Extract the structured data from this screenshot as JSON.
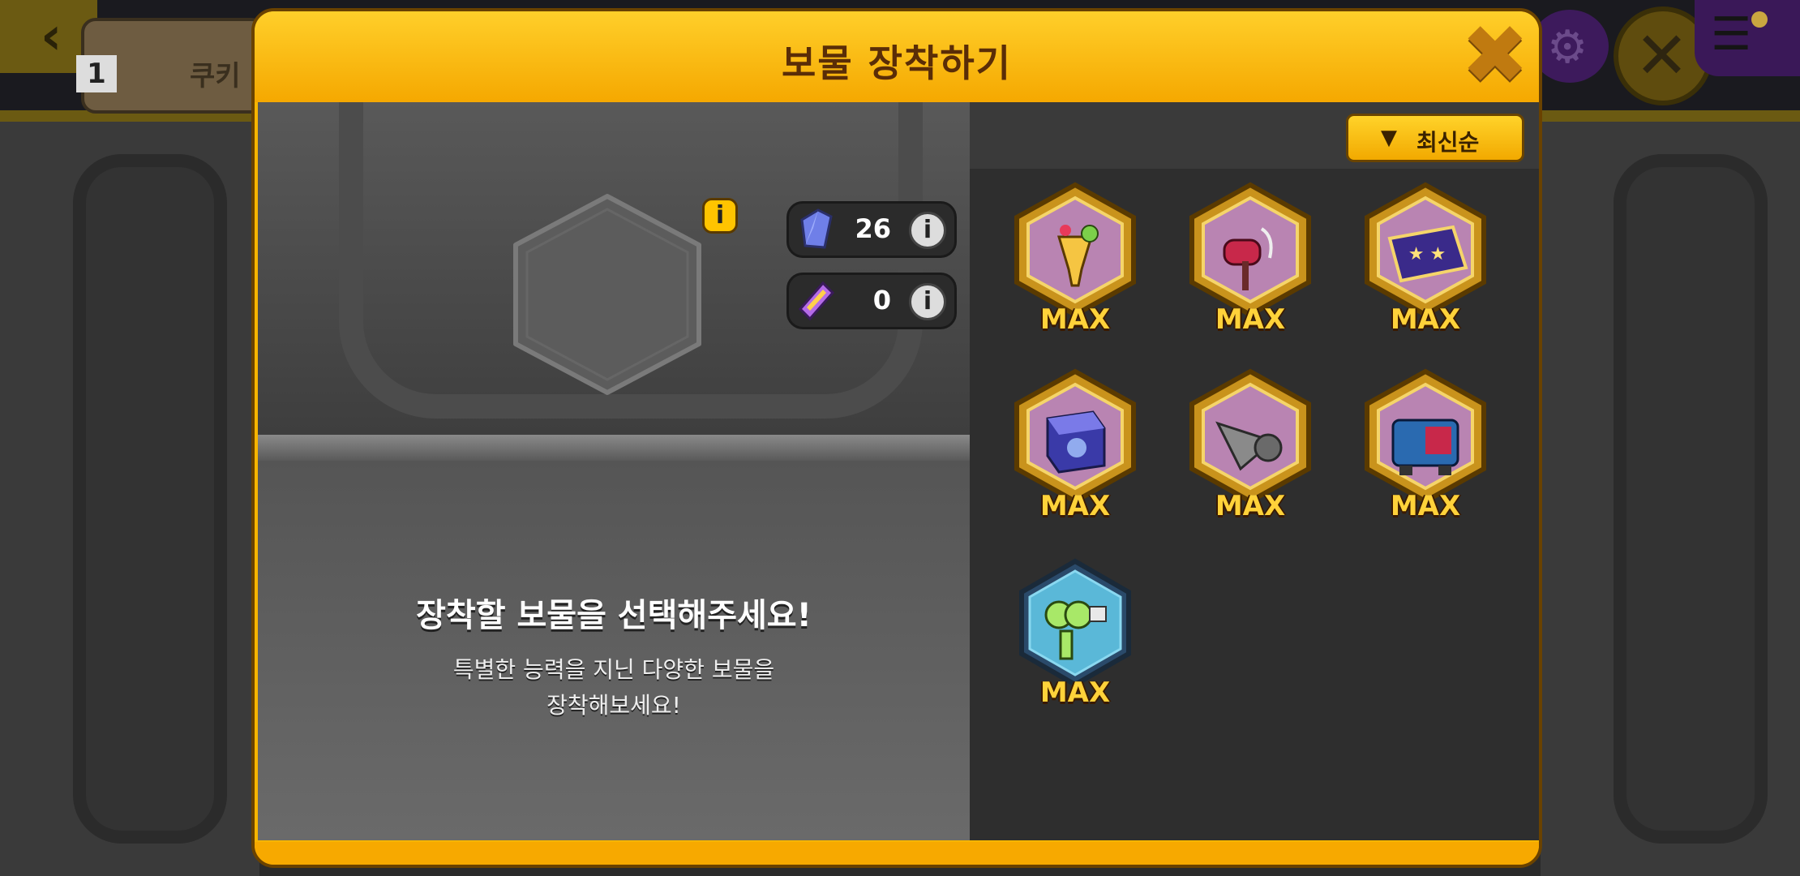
{
  "background": {
    "cookie_tab_number": "1",
    "cookie_tab_label": "쿠키"
  },
  "modal": {
    "title": "보물 장착하기"
  },
  "currencies": [
    {
      "icon": "crystal-icon",
      "value": "26"
    },
    {
      "icon": "ticket-icon",
      "value": "0"
    }
  ],
  "info_label": "i",
  "sort": {
    "label": "최신순"
  },
  "prompt": {
    "title": "장착할 보물을 선택해주세요!",
    "line1": "특별한 능력을 지닌 다양한 보물을",
    "line2": "장착해보세요!"
  },
  "treasures": [
    {
      "name": "tropical-drink",
      "label": "MAX"
    },
    {
      "name": "magic-hammer",
      "label": "MAX"
    },
    {
      "name": "flying-carpet",
      "label": "MAX"
    },
    {
      "name": "magic-cube",
      "label": "MAX"
    },
    {
      "name": "drill-shell",
      "label": "MAX"
    },
    {
      "name": "robot-machine",
      "label": "MAX"
    },
    {
      "name": "bubble-wand",
      "label": "MAX"
    }
  ],
  "colors": {
    "modal_frame": "#f7b500",
    "title_text": "#5a2d07",
    "max_text": "#ffd23a",
    "left_pane": "#4a4a4a",
    "right_pane": "#2e2e2e"
  }
}
